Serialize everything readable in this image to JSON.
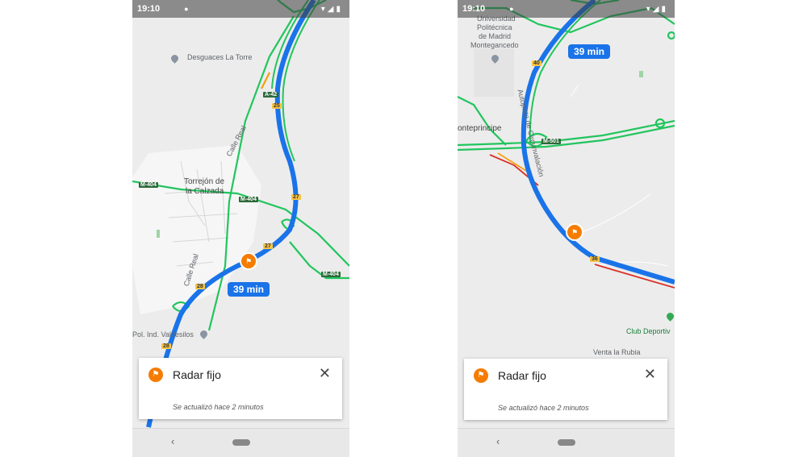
{
  "screens": [
    {
      "status_time": "19:10",
      "route_time": "39 min",
      "map_labels": {
        "desguaces": "Desguaces La Torre",
        "town_1": "Torrejón de",
        "town_2": "la Calzada",
        "calle_real_1": "Calle Real",
        "calle_real_2": "Calle Real",
        "pol_ind": "Pol. Ind. Valdesilos"
      },
      "road_badges": {
        "a42": "A-42",
        "b25": "25",
        "b27a": "27",
        "b27b": "27",
        "b28a": "28",
        "b28b": "28",
        "m404a": "M-404",
        "m404b": "M-404",
        "m404c": "M-404"
      },
      "card": {
        "title": "Radar fijo",
        "subtitle": "Se actualizó hace 2 minutos"
      }
    },
    {
      "status_time": "19:10",
      "route_time": "39 min",
      "map_labels": {
        "univ_1": "Universidad",
        "univ_2": "Politécnica",
        "univ_3": "de Madrid",
        "univ_4": "Montegancedo",
        "monte": "onteprincipe",
        "autopista": "Autopista de Circunvalación",
        "club": "Club Deportiv",
        "venta": "Venta la Rubia"
      },
      "road_badges": {
        "m501": "M-501",
        "b36": "36",
        "b40": "40"
      },
      "card": {
        "title": "Radar fijo",
        "subtitle": "Se actualizó hace 2 minutos"
      }
    }
  ],
  "colors": {
    "route_blue": "#1a73e8",
    "traffic_green": "#22c55e",
    "traffic_orange": "#f59e0b",
    "traffic_red": "#d93025",
    "radar_orange": "#f57c00"
  },
  "icons": [
    "radar-icon",
    "close-icon",
    "back-icon",
    "home-pill-icon",
    "location-pin-icon"
  ]
}
